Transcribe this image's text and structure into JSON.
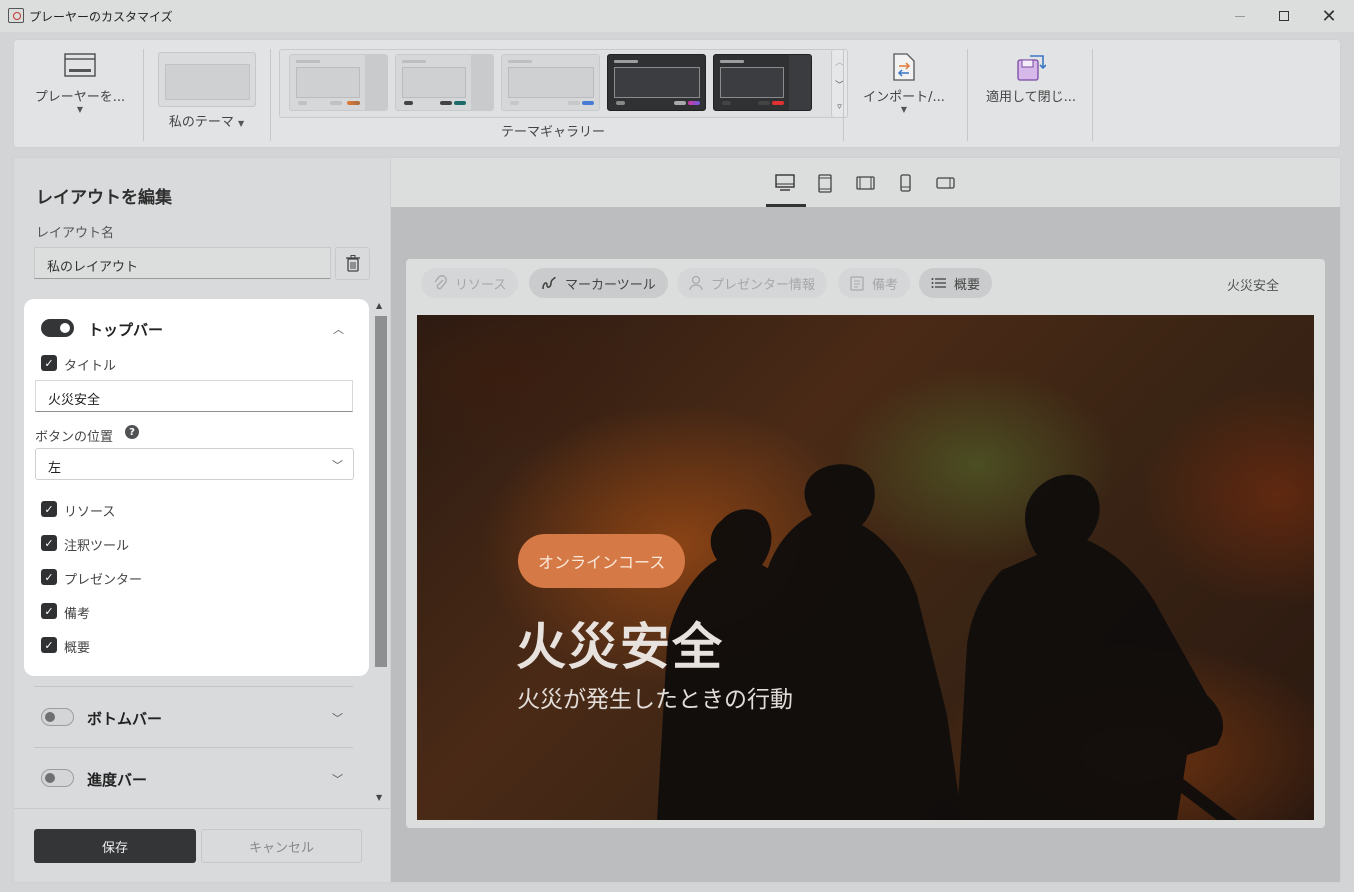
{
  "window": {
    "title": "プレーヤーのカスタマイズ"
  },
  "ribbon": {
    "player_label": "プレーヤーを...",
    "my_theme_label": "私のテーマ",
    "gallery_label": "テーマギャラリー",
    "import_label": "インポート/...",
    "apply_label": "適用して閉じ..."
  },
  "left": {
    "heading": "レイアウトを編集",
    "layout_name_label": "レイアウト名",
    "layout_name_value": "私のレイアウト",
    "top_bar": {
      "title": "トップバー",
      "enabled": true,
      "title_checkbox_label": "タイトル",
      "title_value": "火災安全",
      "button_position_label": "ボタンの位置",
      "button_position_value": "左",
      "options": [
        {
          "label": "リソース",
          "checked": true
        },
        {
          "label": "注釈ツール",
          "checked": true
        },
        {
          "label": "プレゼンター",
          "checked": true
        },
        {
          "label": "備考",
          "checked": true
        },
        {
          "label": "概要",
          "checked": true
        }
      ]
    },
    "bottom_bar": {
      "title": "ボトムバー",
      "enabled": false
    },
    "progress_bar": {
      "title": "進度バー",
      "enabled": false
    },
    "save_label": "保存",
    "cancel_label": "キャンセル"
  },
  "preview": {
    "chips": [
      {
        "label": "リソース",
        "icon": "paperclip-icon",
        "active": false
      },
      {
        "label": "マーカーツール",
        "icon": "marker-tool-icon",
        "active": true
      },
      {
        "label": "プレゼンター情報",
        "icon": "person-icon",
        "active": false
      },
      {
        "label": "備考",
        "icon": "note-icon",
        "active": false
      },
      {
        "label": "概要",
        "icon": "list-icon",
        "active": true
      }
    ],
    "topbar_title": "火災安全",
    "slide": {
      "badge": "オンラインコース",
      "title": "火災安全",
      "subtitle": "火災が発生したときの行動"
    }
  },
  "colors": {
    "accent_dark": "#333537",
    "badge": "#d57a46"
  }
}
